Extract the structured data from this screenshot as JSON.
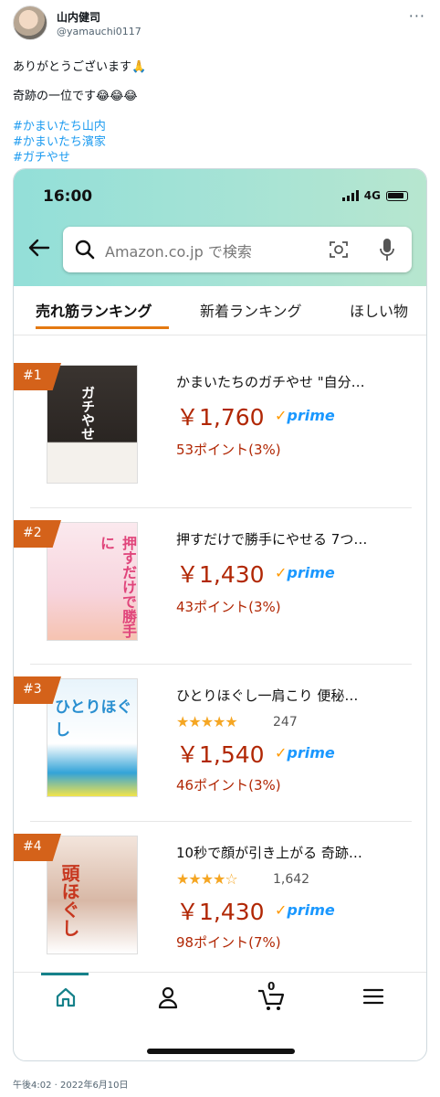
{
  "tweet": {
    "author_name": "山内健司",
    "author_handle": "@yamauchi0117",
    "line1": "ありがとうございます🙏",
    "line2": "奇跡の一位です😂😂😂",
    "hashtags": [
      "#かまいたち山内",
      "#かまいたち濱家",
      "#ガチやせ"
    ],
    "timestamp": "午後4:02 · 2022年6月10日"
  },
  "phone": {
    "status_time": "16:00",
    "network": "4G",
    "search_placeholder": "Amazon.co.jp で検索",
    "tabs": [
      "売れ筋ランキング",
      "新着ランキング",
      "ほしい物"
    ],
    "active_tab": 0,
    "cart_count": "0",
    "items": [
      {
        "rank": "#1",
        "title": "かまいたちのガチやせ \"自分…",
        "price": "￥1,760",
        "prime": "prime",
        "points": "53ポイント(3%)",
        "stars": "",
        "rating_count": "",
        "cover_text": "ガチやせ"
      },
      {
        "rank": "#2",
        "title": "押すだけで勝手にやせる 7つ…",
        "price": "￥1,430",
        "prime": "prime",
        "points": "43ポイント(3%)",
        "stars": "",
        "rating_count": "",
        "cover_text": "押すだけで勝手に"
      },
      {
        "rank": "#3",
        "title": "ひとりほぐし一肩こり 便秘…",
        "price": "￥1,540",
        "prime": "prime",
        "points": "46ポイント(3%)",
        "stars": "★★★★★",
        "rating": 4.5,
        "rating_count": "247",
        "cover_text": "ひとりほぐし"
      },
      {
        "rank": "#4",
        "title": "10秒で顔が引き上がる 奇跡…",
        "price": "￥1,430",
        "prime": "prime",
        "points": "98ポイント(7%)",
        "stars": "★★★★☆",
        "rating": 4.0,
        "rating_count": "1,642",
        "cover_text": "頭ほぐし"
      }
    ]
  },
  "colors": {
    "accent_orange": "#e47911",
    "price_red": "#b12704",
    "prime_blue": "#1a98ff",
    "rank_badge": "#d4621a",
    "hashtag_blue": "#1d9bf0"
  }
}
